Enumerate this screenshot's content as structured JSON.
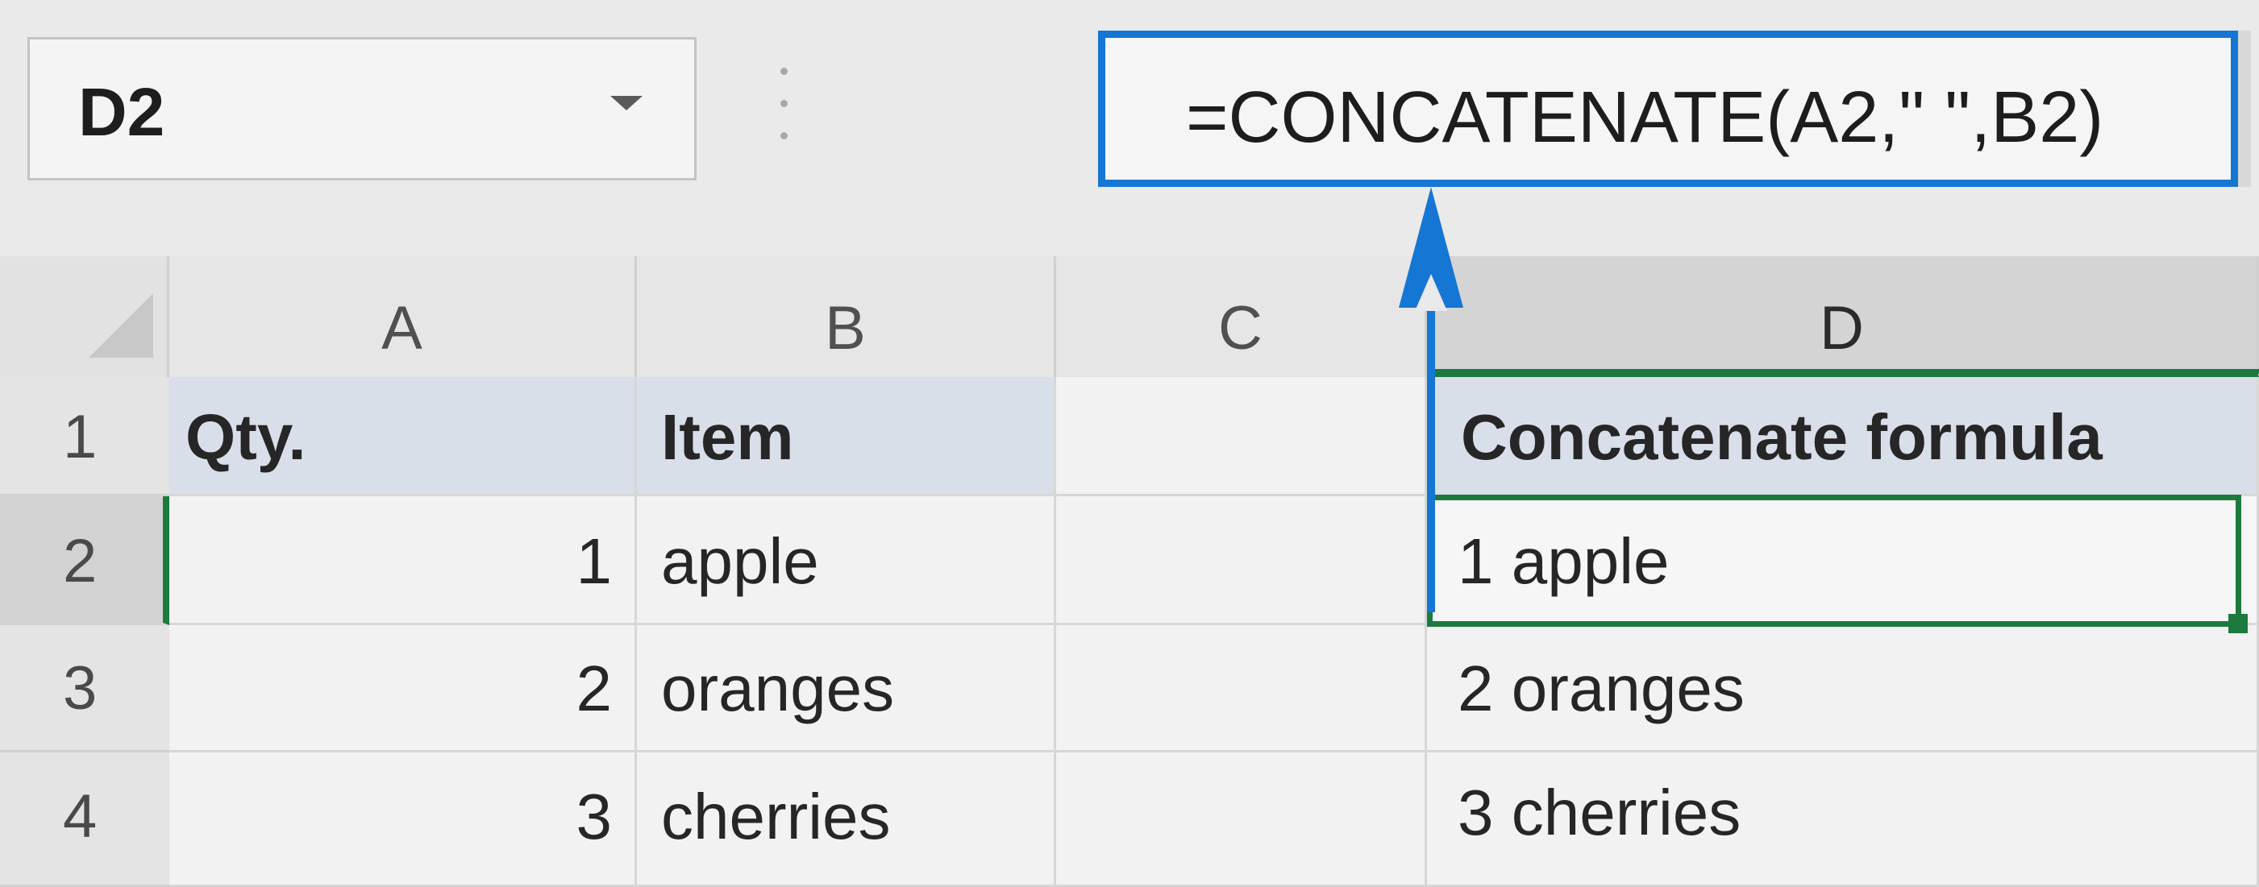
{
  "name_box": {
    "value": "D2"
  },
  "formula_bar": {
    "formula": "=CONCATENATE(A2,\" \",B2)"
  },
  "colors": {
    "accent_blue": "#1576d4",
    "selection_green": "#1d7a3e",
    "header_shade": "#d8dfe8"
  },
  "columns": [
    "A",
    "B",
    "C",
    "D"
  ],
  "rows": [
    {
      "num": "1",
      "a": "Qty.",
      "b": "Item",
      "c": "",
      "d": "Concatenate formula"
    },
    {
      "num": "2",
      "a": "1",
      "b": "apple",
      "c": "",
      "d": "1 apple"
    },
    {
      "num": "3",
      "a": "2",
      "b": "oranges",
      "c": "",
      "d": "2 oranges"
    },
    {
      "num": "4",
      "a": "3",
      "b": "cherries",
      "c": "",
      "d": "3 cherries"
    }
  ]
}
